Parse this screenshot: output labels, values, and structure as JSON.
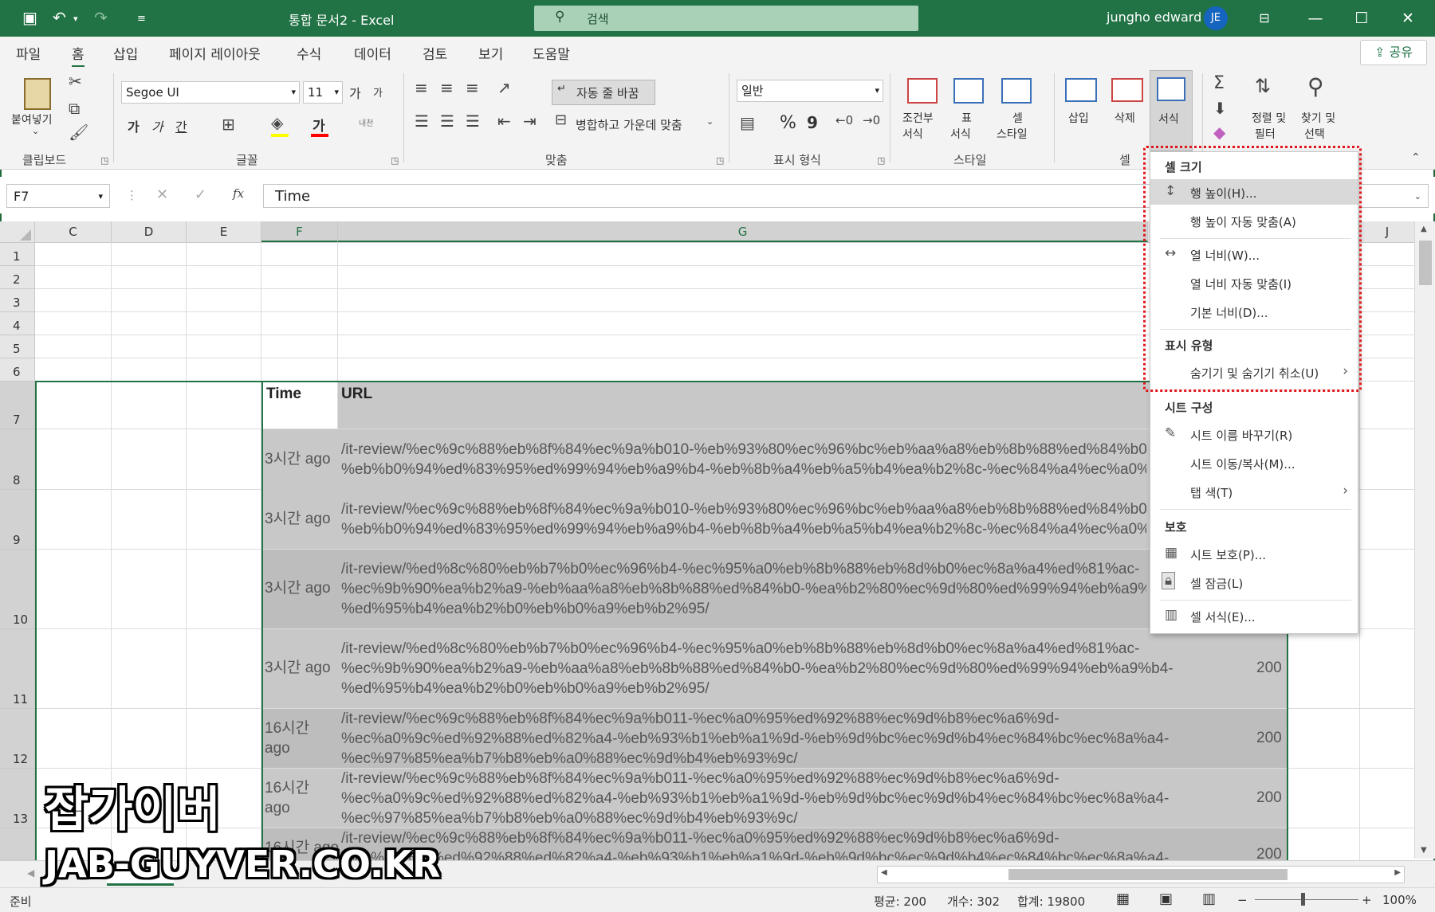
{
  "titlebar": {
    "doc_title": "통합 문서2 - Excel",
    "search_placeholder": "검색",
    "user_name": "jungho edward",
    "user_initials": "JE"
  },
  "ribbon_tabs": [
    "파일",
    "홈",
    "삽입",
    "페이지 레이아웃",
    "수식",
    "데이터",
    "검토",
    "보기",
    "도움말"
  ],
  "share_label": "공유",
  "ribbon": {
    "clipboard": {
      "paste": "붙여넣기",
      "group": "클립보드"
    },
    "font": {
      "name": "Segoe UI",
      "size": "11",
      "bold": "가",
      "italic": "가",
      "underline": "간",
      "color_label": "가",
      "phonetic": "내천",
      "grow": "가",
      "shrink": "가",
      "group": "글꼴"
    },
    "align": {
      "wrap": "자동 줄 바꿈",
      "merge": "병합하고 가운데 맞춤",
      "group": "맞춤"
    },
    "number": {
      "format": "일반",
      "percent": "%",
      "comma": "9",
      "group": "표시 형식"
    },
    "styles": {
      "conditional": [
        "조건부",
        "서식"
      ],
      "table": [
        "표",
        "서식"
      ],
      "cell": [
        "셀",
        "스타일"
      ],
      "group": "스타일"
    },
    "cells": {
      "insert": "삽입",
      "delete": "삭제",
      "format": "서식",
      "group": "셀"
    },
    "editing": {
      "sort": [
        "정렬 및",
        "필터"
      ],
      "find": [
        "찾기 및",
        "선택"
      ]
    }
  },
  "formula_bar": {
    "name_box": "F7",
    "fx": "fx",
    "content": "Time"
  },
  "columns": [
    "C",
    "D",
    "E",
    "F",
    "G",
    "J"
  ],
  "rows": [
    "1",
    "2",
    "3",
    "4",
    "5",
    "6",
    "7",
    "8",
    "9",
    "10",
    "11",
    "12",
    "13"
  ],
  "table": {
    "headers": {
      "time": "Time",
      "url": "URL"
    },
    "rows": [
      {
        "time": "3시간 ago",
        "url": [
          "/it-review/%ec%9c%88%eb%8f%84%ec%9a%b010-%eb%93%80%ec%96%bc%eb%aa%a8%eb%8b%88%ed%84%b0-",
          "%eb%b0%94%ed%83%95%ed%99%94%eb%a9%b4-%eb%8b%a4%eb%a5%b4%ea%b2%8c-%ec%84%a4%ec%a0%95"
        ],
        "status": ""
      },
      {
        "time": "3시간 ago",
        "url": [
          "/it-review/%ec%9c%88%eb%8f%84%ec%9a%b010-%eb%93%80%ec%96%bc%eb%aa%a8%eb%8b%88%ed%84%b0-",
          "%eb%b0%94%ed%83%95%ed%99%94%eb%a9%b4-%eb%8b%a4%eb%a5%b4%ea%b2%8c-%ec%84%a4%ec%a0%95"
        ],
        "status": ""
      },
      {
        "time": "3시간 ago",
        "url": [
          "/it-review/%ed%8c%80%eb%b7%b0%ec%96%b4-%ec%95%a0%eb%8b%88%eb%8d%b0%ec%8a%a4%ed%81%ac-",
          "%ec%9b%90%ea%b2%a9-%eb%aa%a8%eb%8b%88%ed%84%b0-%ea%b2%80%ec%9d%80%ed%99%94%eb%a9%b4-",
          "%ed%95%b4%ea%b2%b0%eb%b0%a9%eb%b2%95/"
        ],
        "status": ""
      },
      {
        "time": "3시간 ago",
        "url": [
          "/it-review/%ed%8c%80%eb%b7%b0%ec%96%b4-%ec%95%a0%eb%8b%88%eb%8d%b0%ec%8a%a4%ed%81%ac-",
          "%ec%9b%90%ea%b2%a9-%eb%aa%a8%eb%8b%88%ed%84%b0-%ea%b2%80%ec%9d%80%ed%99%94%eb%a9%b4-",
          "%ed%95%b4%ea%b2%b0%eb%b0%a9%eb%b2%95/"
        ],
        "status": "200"
      },
      {
        "time": "16시간 ago",
        "url": [
          "/it-review/%ec%9c%88%eb%8f%84%ec%9a%b011-%ec%a0%95%ed%92%88%ec%9d%b8%ec%a6%9d-",
          "%ec%a0%9c%ed%92%88%ed%82%a4-%eb%93%b1%eb%a1%9d-%eb%9d%bc%ec%9d%b4%ec%84%bc%ec%8a%a4-",
          "%ec%97%85%ea%b7%b8%eb%a0%88%ec%9d%b4%eb%93%9c/"
        ],
        "status": "200"
      },
      {
        "time": "16시간 ago",
        "url": [
          "/it-review/%ec%9c%88%eb%8f%84%ec%9a%b011-%ec%a0%95%ed%92%88%ec%9d%b8%ec%a6%9d-",
          "%ec%a0%9c%ed%92%88%ed%82%a4-%eb%93%b1%eb%a1%9d-%eb%9d%bc%ec%9d%b4%ec%84%bc%ec%8a%a4-",
          "%ec%97%85%ea%b7%b8%eb%a0%88%ec%9d%b4%eb%93%9c/"
        ],
        "status": "200"
      },
      {
        "time": "16시간 ago",
        "url": [
          "/it-review/%ec%9c%88%eb%8f%84%ec%9a%b011-%ec%a0%95%ed%92%88%ec%9d%b8%ec%a6%9d-",
          "%ec%a0%9c%ed%92%88%ed%82%a4-%eb%93%b1%eb%a1%9d-%eb%9d%bc%ec%9d%b4%ec%84%bc%ec%8a%a4-"
        ],
        "status": "200"
      }
    ]
  },
  "context_menu": {
    "section_cell_size": "셀 크기",
    "row_height": "행 높이(H)...",
    "autofit_row": "행 높이 자동 맞춤(A)",
    "col_width": "열 너비(W)...",
    "autofit_col": "열 너비 자동 맞춤(I)",
    "default_width": "기본 너비(D)...",
    "section_visibility": "표시 유형",
    "hide_unhide": "숨기기 및 숨기기 취소(U)",
    "section_organize": "시트 구성",
    "rename_sheet": "시트 이름 바꾸기(R)",
    "move_copy": "시트 이동/복사(M)...",
    "tab_color": "탭 색(T)",
    "section_protection": "보호",
    "protect_sheet": "시트 보호(P)...",
    "lock_cell": "셀 잠금(L)",
    "format_cells": "셀 서식(E)..."
  },
  "status_bar": {
    "ready": "준비",
    "average": "평균: 200",
    "count": "개수: 302",
    "sum": "합계: 19800",
    "zoom": "100%"
  },
  "watermark": {
    "line1": "잡가이버",
    "line2": "JAB-GUYVER.CO.KR"
  },
  "colors": {
    "excel_green": "#217346",
    "menu_highlight": "#d9d9d9",
    "dotted_border": "#e0161b"
  }
}
